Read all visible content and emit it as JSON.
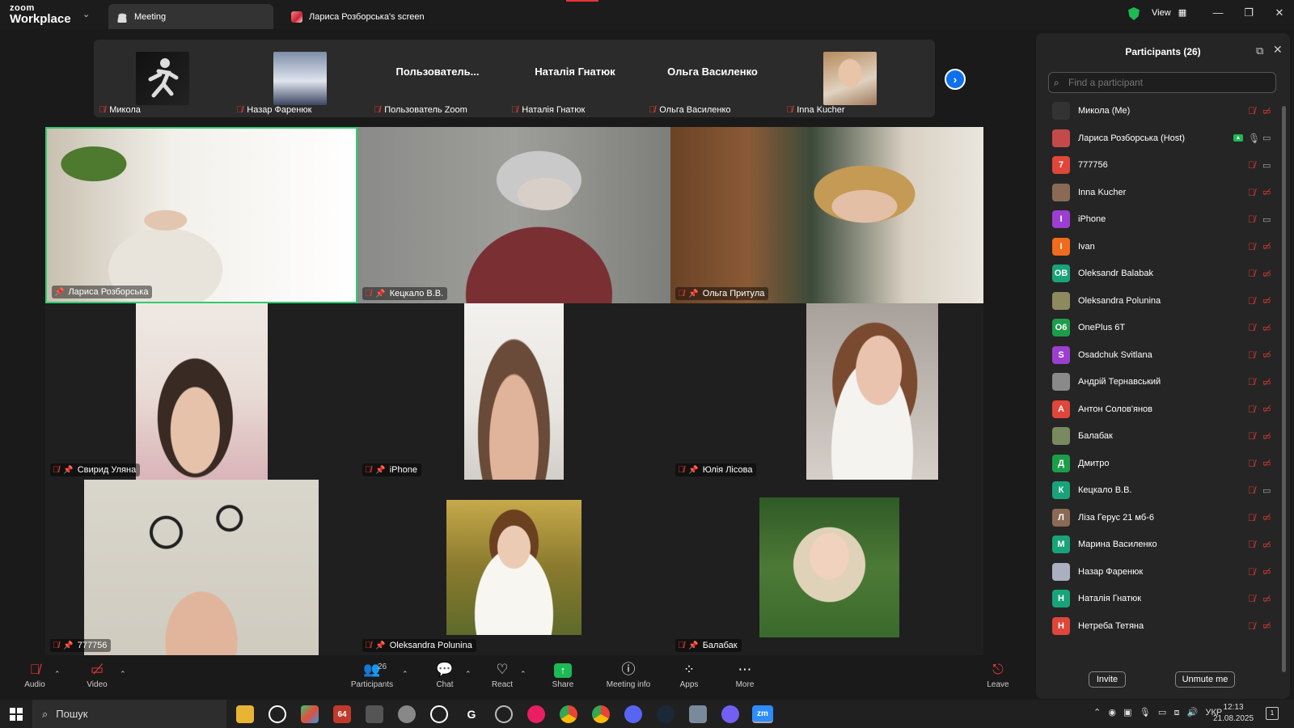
{
  "titlebar": {
    "logo_top": "zoom",
    "logo_bottom": "Workplace",
    "tabs": [
      "Meeting",
      "Лариса Розборська's screen"
    ],
    "view_label": "View"
  },
  "strip": {
    "thumbs": [
      {
        "label": "Микола",
        "name": ""
      },
      {
        "label": "Назар Фаренюк",
        "name": ""
      },
      {
        "label": "Пользователь Zoom",
        "name": "Пользователь..."
      },
      {
        "label": "Наталія Гнатюк",
        "name": "Наталія Гнатюк"
      },
      {
        "label": "Ольга Василенко",
        "name": "Ольга Василенко"
      },
      {
        "label": "Inna Kucher",
        "name": ""
      }
    ],
    "next_icon": "chevron-right-icon"
  },
  "grid": {
    "tiles": [
      {
        "label": "Лариса Розборська"
      },
      {
        "label": "Кецкало В.В."
      },
      {
        "label": "Ольга Притула"
      },
      {
        "label": "Свирид Уляна"
      },
      {
        "label": "iPhone"
      },
      {
        "label": "Юлія Лісова"
      },
      {
        "label": "777756"
      },
      {
        "label": "Oleksandra Polunina"
      },
      {
        "label": "Балабак"
      }
    ]
  },
  "panel": {
    "title": "Participants (26)",
    "search_placeholder": "Find a participant",
    "participants": [
      {
        "name": "Микола (Me)",
        "avatar": "",
        "color": "#333333",
        "cam_on": false
      },
      {
        "name": "Лариса Розборська (Host)",
        "avatar": "",
        "color": "#c44a4a",
        "cam_on": true
      },
      {
        "name": "777756",
        "avatar": "7",
        "color": "#e0463a",
        "cam_on": true
      },
      {
        "name": "Inna Kucher",
        "avatar": "",
        "color": "#8a6a55",
        "cam_on": false
      },
      {
        "name": "iPhone",
        "avatar": "I",
        "color": "#9b3fd0",
        "cam_on": true
      },
      {
        "name": "Ivan",
        "avatar": "I",
        "color": "#f06b1c",
        "cam_on": false
      },
      {
        "name": "Oleksandr Balabak",
        "avatar": "OB",
        "color": "#18a37a",
        "cam_on": false
      },
      {
        "name": "Oleksandra Polunina",
        "avatar": "",
        "color": "#8e8a60",
        "cam_on": false
      },
      {
        "name": "OnePlus 6T",
        "avatar": "O6",
        "color": "#1d9d4a",
        "cam_on": false
      },
      {
        "name": "Osadchuk Svitlana",
        "avatar": "S",
        "color": "#9b3fd0",
        "cam_on": false
      },
      {
        "name": "Андрій Тернавський",
        "avatar": "",
        "color": "#8a8a8a",
        "cam_on": false
      },
      {
        "name": "Антон Солов'янов",
        "avatar": "А",
        "color": "#e0463a",
        "cam_on": false
      },
      {
        "name": "Балабак",
        "avatar": "",
        "color": "#7a8a60",
        "cam_on": false
      },
      {
        "name": "Дмитро",
        "avatar": "Д",
        "color": "#1d9d4a",
        "cam_on": false
      },
      {
        "name": "Кецкало В.В.",
        "avatar": "К",
        "color": "#18a37a",
        "cam_on": true
      },
      {
        "name": "Ліза Герус 21 мб-6",
        "avatar": "Л",
        "color": "#8a6a55",
        "cam_on": false
      },
      {
        "name": "Марина Василенко",
        "avatar": "М",
        "color": "#18a37a",
        "cam_on": false
      },
      {
        "name": "Назар Фаренюк",
        "avatar": "",
        "color": "#aab0c0",
        "cam_on": false
      },
      {
        "name": "Наталія Гнатюк",
        "avatar": "Н",
        "color": "#18a37a",
        "cam_on": false
      },
      {
        "name": "Нетреба Тетяна",
        "avatar": "Н",
        "color": "#e0463a",
        "cam_on": false
      }
    ],
    "invite_label": "Invite",
    "unmute_label": "Unmute me"
  },
  "toolbar": {
    "audio": "Audio",
    "video": "Video",
    "participants": "Participants",
    "participants_count": "26",
    "chat": "Chat",
    "react": "React",
    "share": "Share",
    "meeting_info": "Meeting info",
    "apps": "Apps",
    "more": "More",
    "leave": "Leave"
  },
  "taskbar": {
    "search_label": "Пошук",
    "lang": "УКР",
    "time": "12:13",
    "date": "21.08.2025",
    "notif_count": "1",
    "pinned_app_badge": "64",
    "zoom_app_label": "zm"
  }
}
